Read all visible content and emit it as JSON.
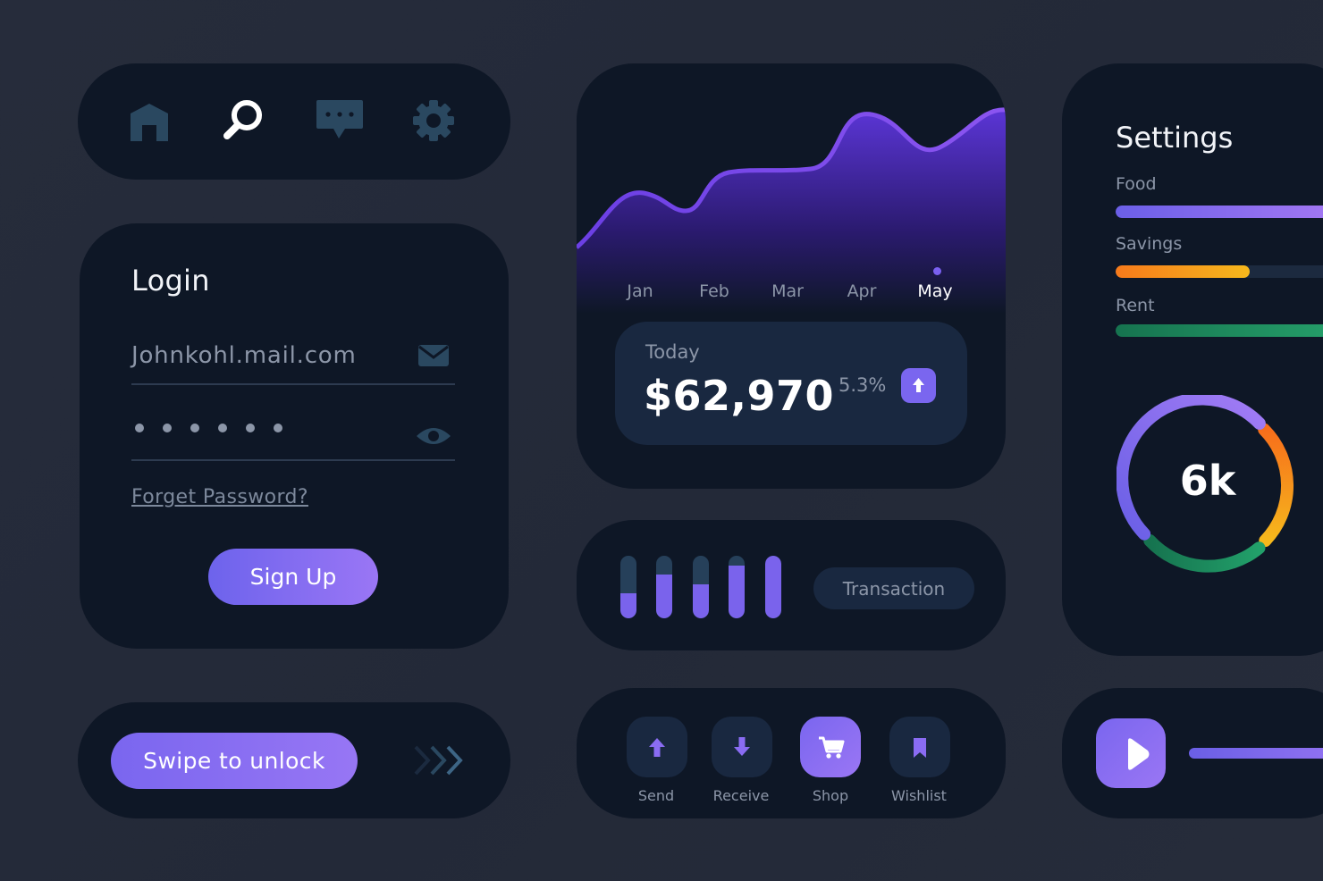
{
  "nav": {
    "icons": [
      "home-icon",
      "search-icon",
      "chat-icon",
      "gear-icon"
    ],
    "active": "search-icon"
  },
  "login": {
    "title": "Login",
    "email_value": "Johnkohl.mail.com",
    "password_mask": "••••••",
    "forgot_label": "Forget Password?",
    "signup_label": "Sign Up"
  },
  "swipe": {
    "label": "Swipe to unlock"
  },
  "earnings": {
    "months": [
      "Jan",
      "Feb",
      "Mar",
      "Apr",
      "May"
    ],
    "active_month": "May",
    "today_label": "Today",
    "today_value": "$62,970",
    "change_pct": "5.3%"
  },
  "transactions": {
    "button_label": "Transaction",
    "bar_levels": [
      0.4,
      0.7,
      0.55,
      0.85,
      1.0
    ]
  },
  "actions": {
    "send_label": "Send",
    "receive_label": "Receive",
    "shop_label": "Shop",
    "wishlist_label": "Wishlist",
    "active": "Shop"
  },
  "settings": {
    "title": "Settings",
    "items": [
      {
        "label": "Food",
        "level": 1.0
      },
      {
        "label": "Savings",
        "level": 0.5
      },
      {
        "label": "Rent",
        "level": 1.0
      }
    ],
    "gauge_value": "6k"
  },
  "player": {
    "progress": 1.0
  },
  "colors": {
    "background": "#252b3a",
    "card": "#0e1726",
    "accent": "#7a66ef",
    "accent_light": "#9a76f4",
    "orange": "#f77f1b",
    "yellow": "#f6b81c",
    "green": "#1f9463",
    "muted_text": "#8c96a8"
  },
  "chart_data": {
    "type": "area",
    "categories": [
      "Jan",
      "Feb",
      "Mar",
      "Apr",
      "May"
    ]
  }
}
